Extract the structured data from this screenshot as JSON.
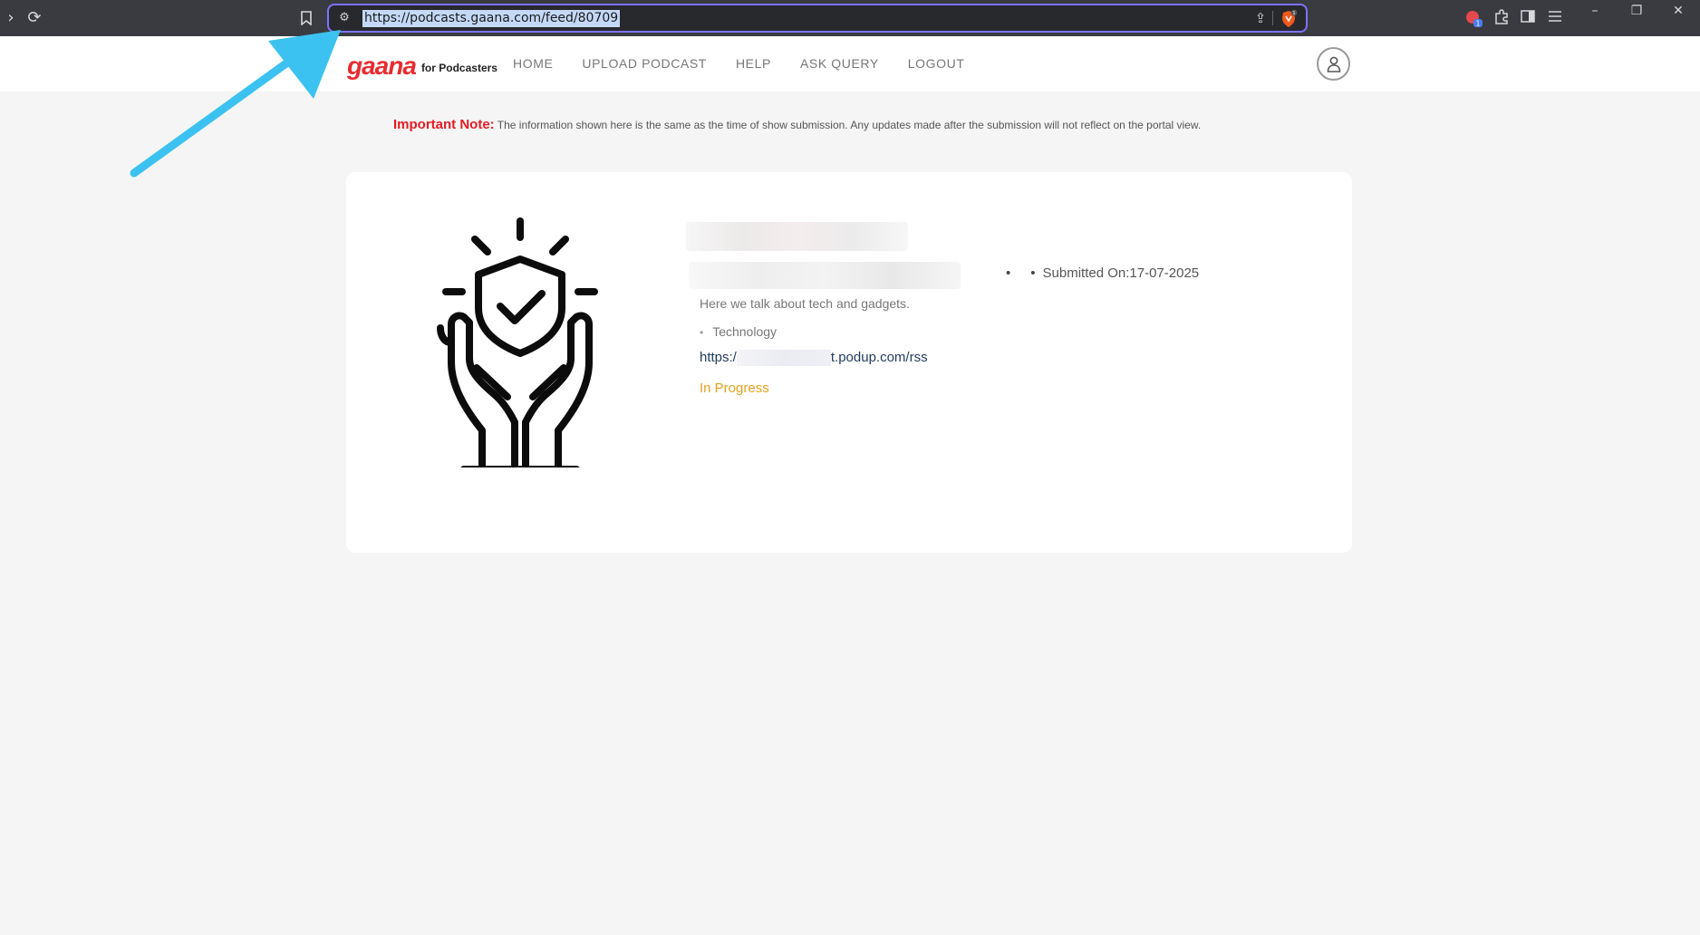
{
  "browser": {
    "url": "https://podcasts.gaana.com/feed/80709",
    "brave_badge": "1",
    "ext_badge": "1"
  },
  "header": {
    "logo_main": "gaana",
    "logo_sub": "for Podcasters",
    "nav": [
      {
        "label": "HOME"
      },
      {
        "label": "UPLOAD PODCAST"
      },
      {
        "label": "HELP"
      },
      {
        "label": "ASK QUERY"
      },
      {
        "label": "LOGOUT"
      }
    ]
  },
  "note": {
    "label": "Important Note:",
    "text": "The information shown here is the same as the time of show submission. Any updates made after the submission will not reflect on the portal view."
  },
  "podcast": {
    "description": "Here we talk about tech and gadgets.",
    "category": "Technology",
    "rss_prefix": "https:/",
    "rss_suffix": "t.podup.com/rss",
    "status": "In Progress",
    "submitted_on": "Submitted On:17-07-2025"
  },
  "colors": {
    "brand_red": "#e72c30",
    "note_red": "#e31b23",
    "status_amber": "#e2a21f",
    "address_focus": "#7d72ff",
    "arrow": "#3cc2f0"
  }
}
